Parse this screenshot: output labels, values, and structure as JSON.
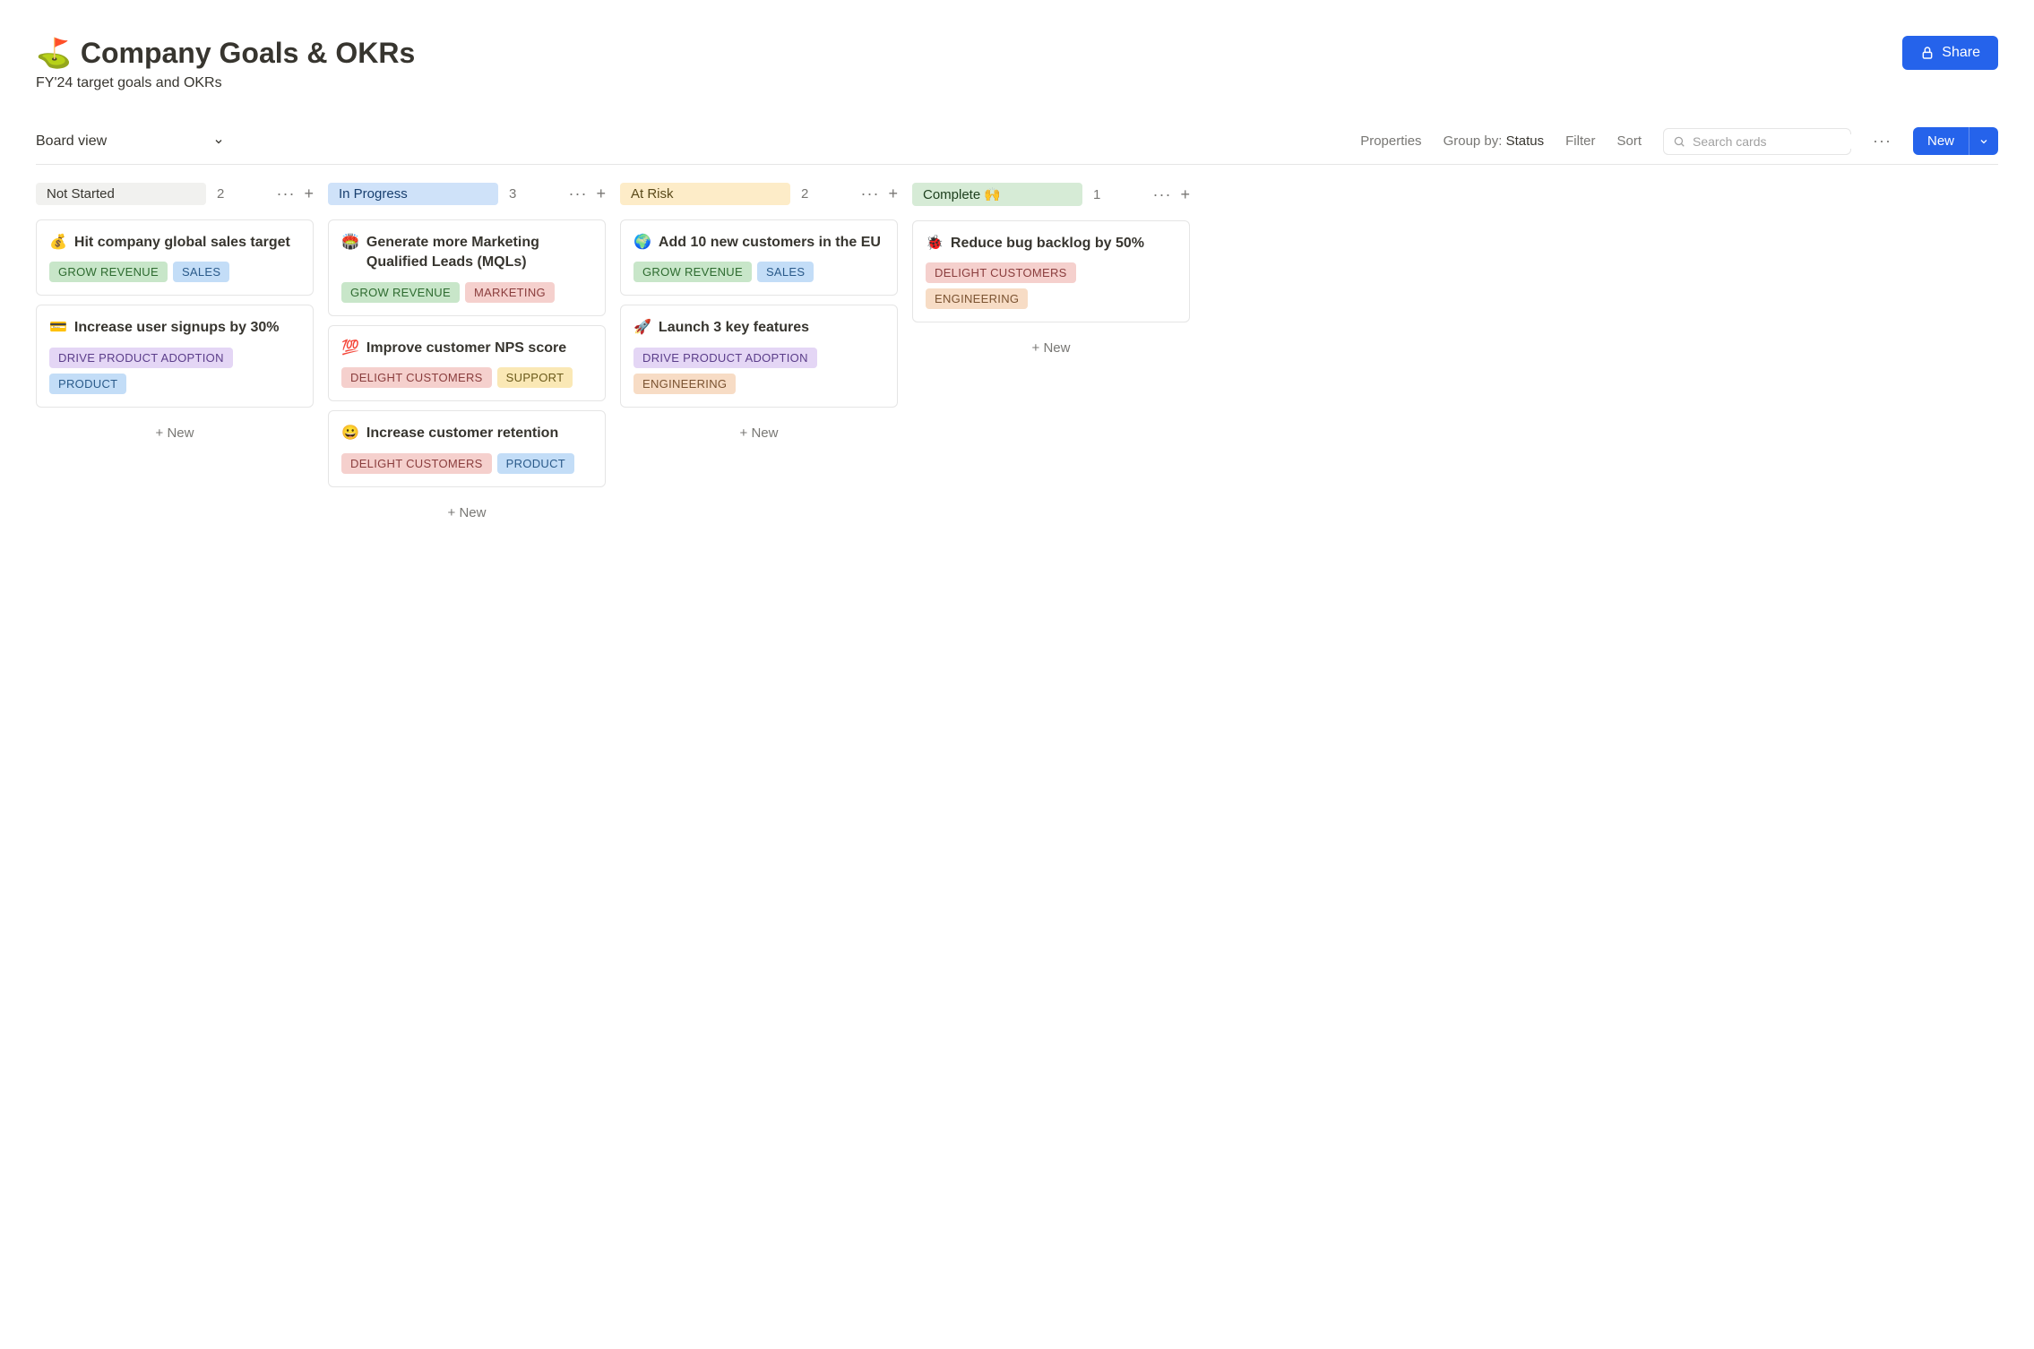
{
  "page": {
    "emoji": "⛳",
    "title": "Company Goals & OKRs",
    "subtitle": "FY'24 target goals and OKRs"
  },
  "share_button": {
    "label": "Share"
  },
  "toolbar": {
    "view": "Board view",
    "properties": "Properties",
    "group_by_label": "Group by:",
    "group_by_value": "Status",
    "filter": "Filter",
    "sort": "Sort",
    "search_placeholder": "Search cards",
    "new_label": "New"
  },
  "tag_colors": {
    "GROW REVENUE": "green",
    "SALES": "blue",
    "DRIVE PRODUCT ADOPTION": "purple",
    "PRODUCT": "blue",
    "MARKETING": "pink",
    "DELIGHT CUSTOMERS": "pink",
    "SUPPORT": "yellow",
    "ENGINEERING": "peach"
  },
  "columns": [
    {
      "id": "not-started",
      "title": "Not Started",
      "class": "col-not-started",
      "count": "2",
      "cards": [
        {
          "emoji": "💰",
          "title": "Hit company global sales target",
          "tags": [
            "GROW REVENUE",
            "SALES"
          ]
        },
        {
          "emoji": "💳",
          "title": "Increase user signups by 30%",
          "tags": [
            "DRIVE PRODUCT ADOPTION",
            "PRODUCT"
          ]
        }
      ]
    },
    {
      "id": "in-progress",
      "title": "In Progress",
      "class": "col-in-progress",
      "count": "3",
      "cards": [
        {
          "emoji": "🏟️",
          "title": "Generate more Marketing Qualified Leads (MQLs)",
          "tags": [
            "GROW REVENUE",
            "MARKETING"
          ]
        },
        {
          "emoji": "💯",
          "title": "Improve customer NPS score",
          "tags": [
            "DELIGHT CUSTOMERS",
            "SUPPORT"
          ]
        },
        {
          "emoji": "😀",
          "title": "Increase customer retention",
          "tags": [
            "DELIGHT CUSTOMERS",
            "PRODUCT"
          ]
        }
      ]
    },
    {
      "id": "at-risk",
      "title": "At Risk",
      "class": "col-at-risk",
      "count": "2",
      "cards": [
        {
          "emoji": "🌍",
          "title": "Add 10 new customers in the EU",
          "tags": [
            "GROW REVENUE",
            "SALES"
          ]
        },
        {
          "emoji": "🚀",
          "title": "Launch 3 key features",
          "tags": [
            "DRIVE PRODUCT ADOPTION",
            "ENGINEERING"
          ]
        }
      ]
    },
    {
      "id": "complete",
      "title": "Complete 🙌",
      "class": "col-complete",
      "count": "1",
      "cards": [
        {
          "emoji": "🐞",
          "title": "Reduce bug backlog by 50%",
          "tags": [
            "DELIGHT CUSTOMERS",
            "ENGINEERING"
          ]
        }
      ]
    }
  ],
  "add_new_label": "+ New"
}
